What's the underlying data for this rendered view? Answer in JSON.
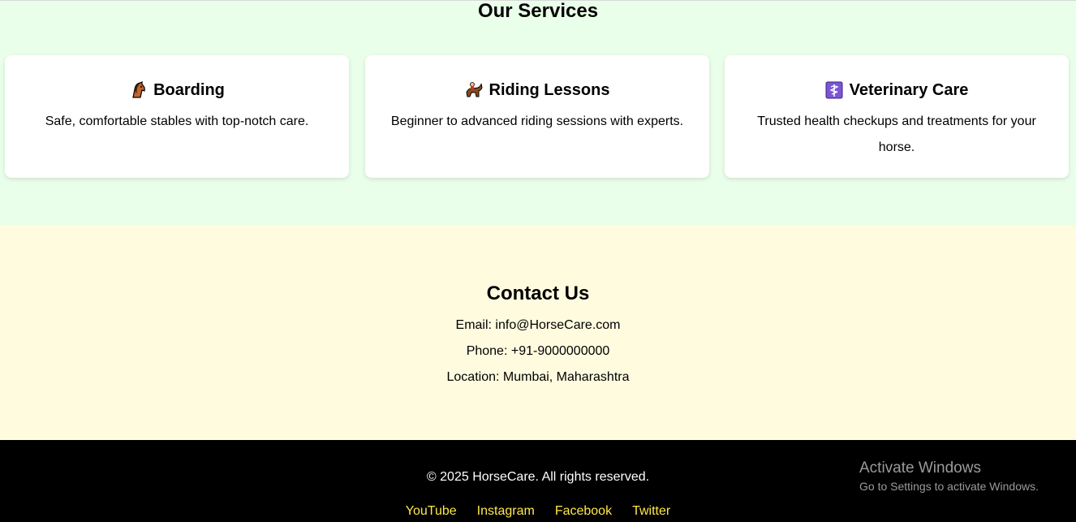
{
  "services": {
    "title": "Our Services",
    "cards": [
      {
        "icon": "horse-head-icon",
        "title": "Boarding",
        "description": "Safe, comfortable stables with top-notch care."
      },
      {
        "icon": "horse-rider-icon",
        "title": "Riding Lessons",
        "description": "Beginner to advanced riding sessions with experts."
      },
      {
        "icon": "medical-symbol-icon",
        "title": "Veterinary Care",
        "description": "Trusted health checkups and treatments for your horse."
      }
    ]
  },
  "contact": {
    "title": "Contact Us",
    "email": "Email: info@HorseCare.com",
    "phone": "Phone: +91-9000000000",
    "location": "Location: Mumbai, Maharashtra"
  },
  "footer": {
    "copyright": "© 2025 HorseCare. All rights reserved.",
    "links": [
      "YouTube",
      "Instagram",
      "Facebook",
      "Twitter"
    ]
  },
  "watermark": {
    "title": "Activate Windows",
    "subtitle": "Go to Settings to activate Windows."
  },
  "colors": {
    "services_bg": "#eaffea",
    "contact_bg": "#fffbdf",
    "footer_bg": "#000000",
    "link": "#ffe84a"
  }
}
